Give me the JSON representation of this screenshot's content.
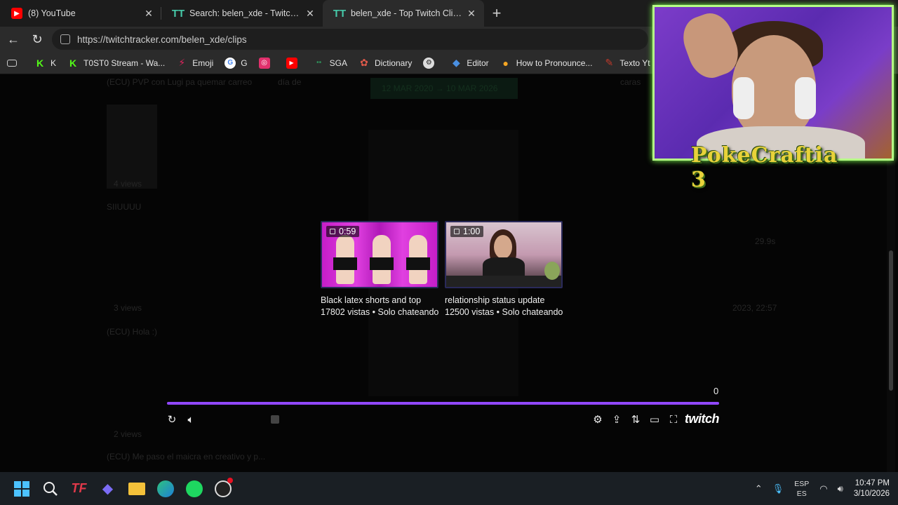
{
  "tabs": [
    {
      "title": "(8) YouTube",
      "icon": "youtube-icon",
      "active": false
    },
    {
      "title": "Search: belen_xde - TwitchTracker",
      "icon": "twitchtracker-icon",
      "active": false
    },
    {
      "title": "belen_xde - Top Twitch Clips - TwitchTracker",
      "icon": "twitchtracker-icon",
      "active": true
    }
  ],
  "address": {
    "url": "https://twitchtracker.com/belen_xde/clips"
  },
  "bookmarks": [
    {
      "label": "K",
      "color": "#53fc18",
      "glyph": "K"
    },
    {
      "label": "T0ST0 Stream - Wa...",
      "color": "#53fc18",
      "glyph": "K"
    },
    {
      "label": "Emoji",
      "color": "#e0245e",
      "glyph": "⚡"
    },
    {
      "label": "G",
      "color": "#ffffff",
      "glyph": "G"
    },
    {
      "label": "",
      "color": "#e1306c",
      "glyph": "◎"
    },
    {
      "label": "",
      "color": "#ff0000",
      "glyph": "▶"
    },
    {
      "label": "SGA",
      "color": "#2e8b57",
      "glyph": "•"
    },
    {
      "label": "Dictionary",
      "color": "#c0392b",
      "glyph": "✿"
    },
    {
      "label": "",
      "color": "#aaaaaa",
      "glyph": "⚙"
    },
    {
      "label": "Editor",
      "color": "#4a90e2",
      "glyph": "◆"
    },
    {
      "label": "How to Pronounce...",
      "color": "#f5a623",
      "glyph": "●"
    },
    {
      "label": "Texto Yt",
      "color": "#c0392b",
      "glyph": "✎"
    }
  ],
  "background_text": {
    "row1": "(ECU) PVP con Lugi pa quemar carreo",
    "row1b": "día de",
    "row1c": "caras",
    "date_range": "12 MAR 2020 → 10 MAR 2026",
    "views1": "4 views",
    "siuuu": "SIIUUUU",
    "dur": "29.9s",
    "views2": "3 views",
    "date2": "2023, 22:57",
    "hola": "(ECU) Hola :)",
    "views3": "2 views",
    "row_last": "(ECU) Me paso el maicra en creativo y p..."
  },
  "clips": [
    {
      "duration": "0:59",
      "title": "Black latex shorts and top",
      "meta": "17802 vistas • Solo chateando",
      "thumb_color": "#d030d0"
    },
    {
      "duration": "1:00",
      "title": "relationship status update",
      "meta": "12500 vistas • Solo chateando",
      "thumb_color": "#b07a9a"
    }
  ],
  "player": {
    "counter": "0",
    "progress": 1.0,
    "brand": "twitch",
    "accent": "#9147ff"
  },
  "overlay": {
    "logo_text": "PokeCraftia 3"
  },
  "tray": {
    "lang_top": "ESP",
    "lang_bottom": "ES",
    "time": "10:47 PM",
    "date": "3/10/2026"
  }
}
